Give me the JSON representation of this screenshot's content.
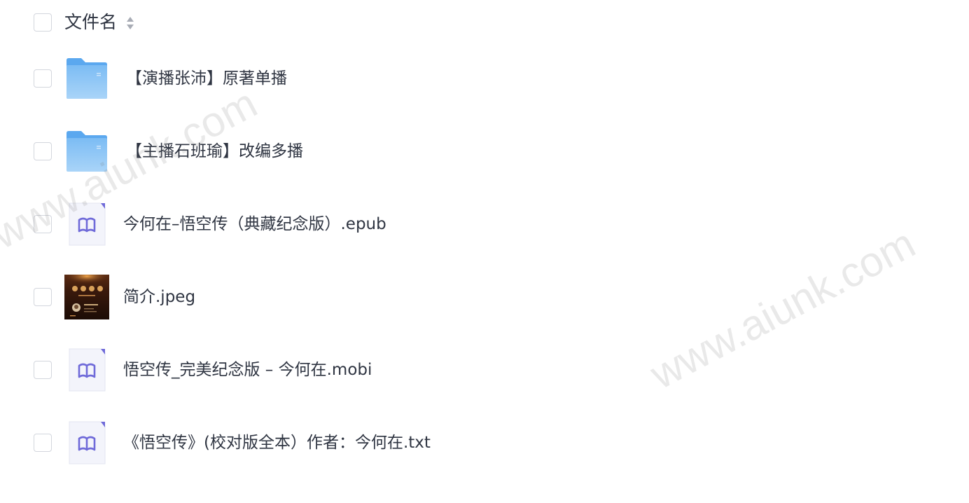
{
  "header": {
    "filename_label": "文件名",
    "sort_icon": "sort-up-down-icon"
  },
  "files": [
    {
      "name": "【演播张沛】原著单播",
      "type": "folder",
      "icon": "folder-icon"
    },
    {
      "name": "【主播石班瑜】改编多播",
      "type": "folder",
      "icon": "folder-icon"
    },
    {
      "name": "今何在–悟空传（典藏纪念版）.epub",
      "type": "ebook",
      "icon": "ebook-file-icon"
    },
    {
      "name": "简介.jpeg",
      "type": "image",
      "icon": "image-thumbnail"
    },
    {
      "name": "悟空传_完美纪念版 – 今何在.mobi",
      "type": "ebook",
      "icon": "ebook-file-icon"
    },
    {
      "name": "《悟空传》(校对版全本）作者：今何在.txt",
      "type": "ebook",
      "icon": "ebook-file-icon"
    }
  ],
  "watermarks": [
    "www.aiunk.com",
    "www.aiunk.com"
  ],
  "colors": {
    "folder_light": "#8cc4f5",
    "folder_dark": "#5ba8ef",
    "ebook_accent": "#6f6ad9",
    "checkbox_border": "#d3d6dd",
    "text": "#2f3542"
  }
}
